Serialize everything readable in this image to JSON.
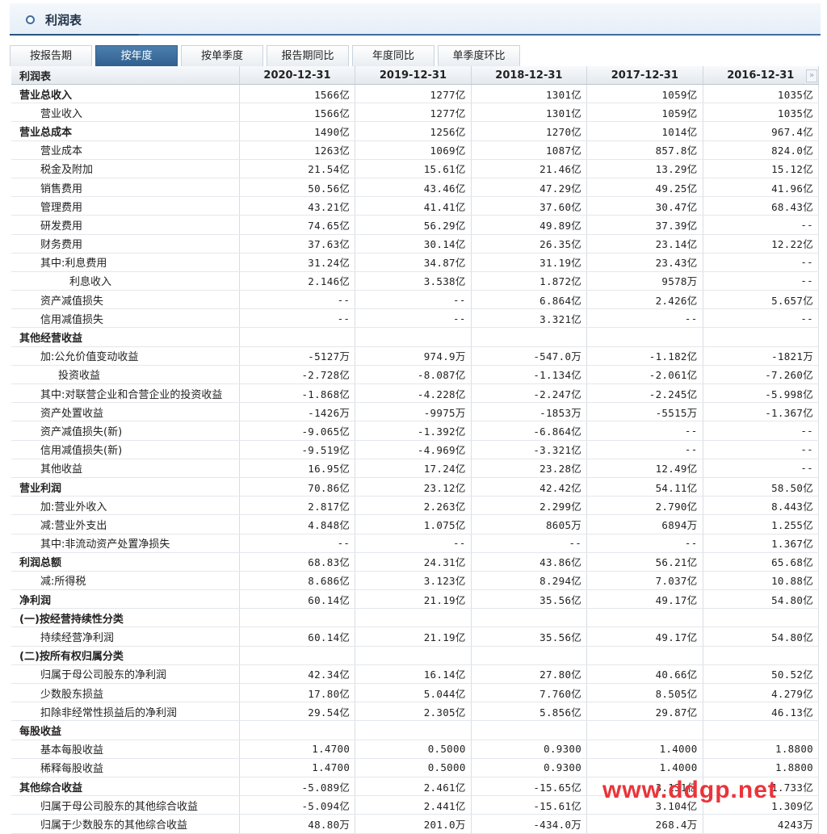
{
  "panel": {
    "title": "利润表"
  },
  "tabs": [
    {
      "label": "按报告期",
      "active": false
    },
    {
      "label": "按年度",
      "active": true
    },
    {
      "label": "按单季度",
      "active": false
    },
    {
      "label": "报告期同比",
      "active": false
    },
    {
      "label": "年度同比",
      "active": false
    },
    {
      "label": "单季度环比",
      "active": false
    }
  ],
  "table": {
    "corner": "利润表",
    "columns": [
      "2020-12-31",
      "2019-12-31",
      "2018-12-31",
      "2017-12-31",
      "2016-12-31"
    ],
    "rows": [
      {
        "label": "营业总收入",
        "bold": true,
        "indent": 0,
        "values": [
          "1566亿",
          "1277亿",
          "1301亿",
          "1059亿",
          "1035亿"
        ]
      },
      {
        "label": "营业收入",
        "indent": 1,
        "values": [
          "1566亿",
          "1277亿",
          "1301亿",
          "1059亿",
          "1035亿"
        ]
      },
      {
        "label": "营业总成本",
        "bold": true,
        "indent": 0,
        "values": [
          "1490亿",
          "1256亿",
          "1270亿",
          "1014亿",
          "967.4亿"
        ]
      },
      {
        "label": "营业成本",
        "indent": 1,
        "values": [
          "1263亿",
          "1069亿",
          "1087亿",
          "857.8亿",
          "824.0亿"
        ]
      },
      {
        "label": "税金及附加",
        "indent": 1,
        "values": [
          "21.54亿",
          "15.61亿",
          "21.46亿",
          "13.29亿",
          "15.12亿"
        ]
      },
      {
        "label": "销售费用",
        "indent": 1,
        "values": [
          "50.56亿",
          "43.46亿",
          "47.29亿",
          "49.25亿",
          "41.96亿"
        ]
      },
      {
        "label": "管理费用",
        "indent": 1,
        "values": [
          "43.21亿",
          "41.41亿",
          "37.60亿",
          "30.47亿",
          "68.43亿"
        ]
      },
      {
        "label": "研发费用",
        "indent": 1,
        "values": [
          "74.65亿",
          "56.29亿",
          "49.89亿",
          "37.39亿",
          "--"
        ]
      },
      {
        "label": "财务费用",
        "indent": 1,
        "values": [
          "37.63亿",
          "30.14亿",
          "26.35亿",
          "23.14亿",
          "12.22亿"
        ]
      },
      {
        "label": "其中:利息费用",
        "indent": 1,
        "values": [
          "31.24亿",
          "34.87亿",
          "31.19亿",
          "23.43亿",
          "--"
        ]
      },
      {
        "label": "利息收入",
        "indent": 3,
        "values": [
          "2.146亿",
          "3.538亿",
          "1.872亿",
          "9578万",
          "--"
        ]
      },
      {
        "label": "资产减值损失",
        "indent": 1,
        "values": [
          "--",
          "--",
          "6.864亿",
          "2.426亿",
          "5.657亿"
        ]
      },
      {
        "label": "信用减值损失",
        "indent": 1,
        "values": [
          "--",
          "--",
          "3.321亿",
          "--",
          "--"
        ]
      },
      {
        "label": "其他经营收益",
        "bold": true,
        "indent": 0,
        "values": [
          "",
          "",
          "",
          "",
          ""
        ]
      },
      {
        "label": "加:公允价值变动收益",
        "indent": 1,
        "values": [
          "-5127万",
          "974.9万",
          "-547.0万",
          "-1.182亿",
          "-1821万"
        ]
      },
      {
        "label": "投资收益",
        "indent": 2,
        "values": [
          "-2.728亿",
          "-8.087亿",
          "-1.134亿",
          "-2.061亿",
          "-7.260亿"
        ]
      },
      {
        "label": "其中:对联营企业和合营企业的投资收益",
        "indent": 1,
        "values": [
          "-1.868亿",
          "-4.228亿",
          "-2.247亿",
          "-2.245亿",
          "-5.998亿"
        ]
      },
      {
        "label": "资产处置收益",
        "indent": 1,
        "values": [
          "-1426万",
          "-9975万",
          "-1853万",
          "-5515万",
          "-1.367亿"
        ]
      },
      {
        "label": "资产减值损失(新)",
        "indent": 1,
        "values": [
          "-9.065亿",
          "-1.392亿",
          "-6.864亿",
          "--",
          "--"
        ]
      },
      {
        "label": "信用减值损失(新)",
        "indent": 1,
        "values": [
          "-9.519亿",
          "-4.969亿",
          "-3.321亿",
          "--",
          "--"
        ]
      },
      {
        "label": "其他收益",
        "indent": 1,
        "values": [
          "16.95亿",
          "17.24亿",
          "23.28亿",
          "12.49亿",
          "--"
        ]
      },
      {
        "label": "营业利润",
        "bold": true,
        "indent": 0,
        "values": [
          "70.86亿",
          "23.12亿",
          "42.42亿",
          "54.11亿",
          "58.50亿"
        ]
      },
      {
        "label": "加:营业外收入",
        "indent": 1,
        "values": [
          "2.817亿",
          "2.263亿",
          "2.299亿",
          "2.790亿",
          "8.443亿"
        ]
      },
      {
        "label": "减:营业外支出",
        "indent": 1,
        "values": [
          "4.848亿",
          "1.075亿",
          "8605万",
          "6894万",
          "1.255亿"
        ]
      },
      {
        "label": "其中:非流动资产处置净损失",
        "indent": 1,
        "values": [
          "--",
          "--",
          "--",
          "--",
          "1.367亿"
        ]
      },
      {
        "label": "利润总额",
        "bold": true,
        "indent": 0,
        "values": [
          "68.83亿",
          "24.31亿",
          "43.86亿",
          "56.21亿",
          "65.68亿"
        ]
      },
      {
        "label": "减:所得税",
        "indent": 1,
        "values": [
          "8.686亿",
          "3.123亿",
          "8.294亿",
          "7.037亿",
          "10.88亿"
        ]
      },
      {
        "label": "净利润",
        "bold": true,
        "indent": 0,
        "values": [
          "60.14亿",
          "21.19亿",
          "35.56亿",
          "49.17亿",
          "54.80亿"
        ]
      },
      {
        "label": "(一)按经营持续性分类",
        "bold": true,
        "indent": 0,
        "values": [
          "",
          "",
          "",
          "",
          ""
        ]
      },
      {
        "label": "持续经营净利润",
        "indent": 1,
        "values": [
          "60.14亿",
          "21.19亿",
          "35.56亿",
          "49.17亿",
          "54.80亿"
        ]
      },
      {
        "label": "(二)按所有权归属分类",
        "bold": true,
        "indent": 0,
        "values": [
          "",
          "",
          "",
          "",
          ""
        ]
      },
      {
        "label": "归属于母公司股东的净利润",
        "indent": 1,
        "values": [
          "42.34亿",
          "16.14亿",
          "27.80亿",
          "40.66亿",
          "50.52亿"
        ]
      },
      {
        "label": "少数股东损益",
        "indent": 1,
        "values": [
          "17.80亿",
          "5.044亿",
          "7.760亿",
          "8.505亿",
          "4.279亿"
        ]
      },
      {
        "label": "扣除非经常性损益后的净利润",
        "indent": 1,
        "values": [
          "29.54亿",
          "2.305亿",
          "5.856亿",
          "29.87亿",
          "46.13亿"
        ]
      },
      {
        "label": "每股收益",
        "bold": true,
        "indent": 0,
        "values": [
          "",
          "",
          "",
          "",
          ""
        ]
      },
      {
        "label": "基本每股收益",
        "indent": 1,
        "values": [
          "1.4700",
          "0.5000",
          "0.9300",
          "1.4000",
          "1.8800"
        ]
      },
      {
        "label": "稀释每股收益",
        "indent": 1,
        "values": [
          "1.4700",
          "0.5000",
          "0.9300",
          "1.4000",
          "1.8800"
        ]
      },
      {
        "label": "其他综合收益",
        "bold": true,
        "indent": 0,
        "values": [
          "-5.089亿",
          "2.461亿",
          "-15.65亿",
          "3.131亿",
          "1.733亿"
        ]
      },
      {
        "label": "归属于母公司股东的其他综合收益",
        "indent": 1,
        "values": [
          "-5.094亿",
          "2.441亿",
          "-15.61亿",
          "3.104亿",
          "1.309亿"
        ]
      },
      {
        "label": "归属于少数股东的其他综合收益",
        "indent": 1,
        "values": [
          "48.80万",
          "201.0万",
          "-434.0万",
          "268.4万",
          "4243万"
        ]
      }
    ]
  },
  "scroll": {
    "glyph": "»"
  },
  "watermark": {
    "text": "www.ddgp.net"
  }
}
